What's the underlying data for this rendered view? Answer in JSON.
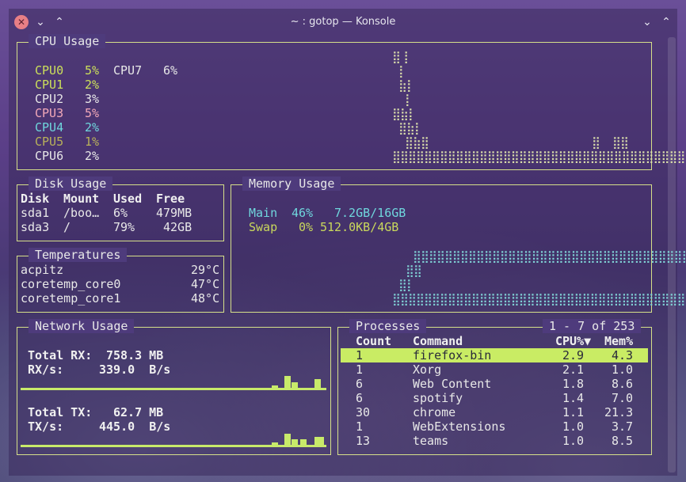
{
  "window": {
    "title": "~ : gotop — Konsole"
  },
  "cpu": {
    "title": "CPU Usage",
    "cores": [
      {
        "name": "CPU0",
        "value": "5%",
        "color": "#cce05a"
      },
      {
        "name": "CPU1",
        "value": "2%",
        "color": "#cce05a"
      },
      {
        "name": "CPU2",
        "value": "3%",
        "color": "#e8e8e8"
      },
      {
        "name": "CPU3",
        "value": "5%",
        "color": "#f2a9b8"
      },
      {
        "name": "CPU4",
        "value": "2%",
        "color": "#6fd7dd"
      },
      {
        "name": "CPU5",
        "value": "1%",
        "color": "#b9b25a"
      },
      {
        "name": "CPU6",
        "value": "2%",
        "color": "#e8e8e8"
      },
      {
        "name": "CPU7",
        "value": "6%",
        "color": "#e8e8e8"
      }
    ]
  },
  "disk": {
    "title": "Disk Usage",
    "headers": [
      "Disk",
      "Mount",
      "Used",
      "Free"
    ],
    "rows": [
      [
        "sda1",
        "/boo…",
        "6%",
        "479MB"
      ],
      [
        "sda3",
        "/",
        "79%",
        "42GB"
      ]
    ]
  },
  "temps": {
    "title": "Temperatures",
    "rows": [
      [
        "acpitz",
        "29°C"
      ],
      [
        "coretemp_core0",
        "47°C"
      ],
      [
        "coretemp_core1",
        "48°C"
      ]
    ]
  },
  "memory": {
    "title": "Memory Usage",
    "main": {
      "label": "Main",
      "percent": "46%",
      "amount": "7.2GB/16GB"
    },
    "swap": {
      "label": "Swap",
      "percent": "0%",
      "amount": "512.0KB/4GB"
    }
  },
  "network": {
    "title": "Network Usage",
    "total_rx_label": "Total RX:",
    "total_rx": "758.3 MB",
    "rx_rate_label": "RX/s:",
    "rx_rate": "339.0  B/s",
    "total_tx_label": "Total TX:",
    "total_tx": "62.7 MB",
    "tx_rate_label": "TX/s:",
    "tx_rate": "445.0  B/s"
  },
  "processes": {
    "title": "Processes",
    "range": "1 - 7 of 253",
    "headers": [
      "Count",
      "Command",
      "CPU%▼",
      "Mem%"
    ],
    "rows": [
      [
        "1",
        "firefox-bin",
        "2.9",
        "4.3"
      ],
      [
        "1",
        "Xorg",
        "2.1",
        "1.0"
      ],
      [
        "6",
        "Web Content",
        "1.8",
        "8.6"
      ],
      [
        "6",
        "spotify",
        "1.4",
        "7.0"
      ],
      [
        "30",
        "chrome",
        "1.1",
        "21.3"
      ],
      [
        "1",
        "WebExtensions",
        "1.0",
        "3.7"
      ],
      [
        "13",
        "teams",
        "1.0",
        "8.5"
      ]
    ]
  },
  "colors": {
    "accent": "#c9ec64",
    "border": "#d6e08a"
  }
}
